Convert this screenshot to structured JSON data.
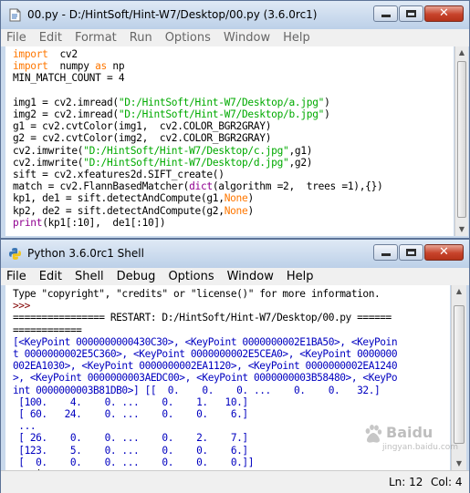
{
  "editor": {
    "title": "00.py - D:/HintSoft/Hint-W7/Desktop/00.py (3.6.0rc1)",
    "menu": [
      "File",
      "Edit",
      "Format",
      "Run",
      "Options",
      "Window",
      "Help"
    ],
    "code": [
      [
        [
          "kw",
          "import"
        ],
        [
          "",
          "  cv2"
        ]
      ],
      [
        [
          "kw",
          "import"
        ],
        [
          "",
          "  numpy "
        ],
        [
          "kw",
          "as"
        ],
        [
          "",
          " np"
        ]
      ],
      [
        [
          "",
          "MIN_MATCH_COUNT = 4"
        ]
      ],
      [
        [
          "",
          ""
        ]
      ],
      [
        [
          "",
          "img1 = cv2.imread("
        ],
        [
          "str",
          "\"D:/HintSoft/Hint-W7/Desktop/a.jpg\""
        ],
        [
          "",
          ")"
        ]
      ],
      [
        [
          "",
          "img2 = cv2.imread("
        ],
        [
          "str",
          "\"D:/HintSoft/Hint-W7/Desktop/b.jpg\""
        ],
        [
          "",
          ")"
        ]
      ],
      [
        [
          "",
          "g1 = cv2.cvtColor(img1,  cv2.COLOR_BGR2GRAY)"
        ]
      ],
      [
        [
          "",
          "g2 = cv2.cvtColor(img2,  cv2.COLOR_BGR2GRAY)"
        ]
      ],
      [
        [
          "",
          "cv2.imwrite("
        ],
        [
          "str",
          "\"D:/HintSoft/Hint-W7/Desktop/c.jpg\""
        ],
        [
          "",
          ",g1)"
        ]
      ],
      [
        [
          "",
          "cv2.imwrite("
        ],
        [
          "str",
          "\"D:/HintSoft/Hint-W7/Desktop/d.jpg\""
        ],
        [
          "",
          ",g2)"
        ]
      ],
      [
        [
          "",
          "sift = cv2.xfeatures2d.SIFT_create()"
        ]
      ],
      [
        [
          "",
          "match = cv2.FlannBasedMatcher("
        ],
        [
          "bi",
          "dict"
        ],
        [
          "",
          "(algorithm =2,  trees =1),{})"
        ]
      ],
      [
        [
          "",
          "kp1, de1 = sift.detectAndCompute(g1,"
        ],
        [
          "kw",
          "None"
        ],
        [
          "",
          ")"
        ]
      ],
      [
        [
          "",
          "kp2, de2 = sift.detectAndCompute(g2,"
        ],
        [
          "kw",
          "None"
        ],
        [
          "",
          ")"
        ]
      ],
      [
        [
          "bi",
          "print"
        ],
        [
          "",
          "(kp1[:10],  de1[:10])"
        ]
      ]
    ]
  },
  "shell": {
    "title": "Python 3.6.0rc1 Shell",
    "menu": [
      "File",
      "Edit",
      "Shell",
      "Debug",
      "Options",
      "Window",
      "Help"
    ],
    "lines": [
      [
        [
          "",
          "Type \"copyright\", \"credits\" or \"license()\" for more information."
        ]
      ],
      [
        [
          "prompt",
          ">>> "
        ]
      ],
      [
        [
          "",
          "================ RESTART: D:/HintSoft/Hint-W7/Desktop/00.py ======"
        ]
      ],
      [
        [
          "",
          "============"
        ]
      ],
      [
        [
          "out",
          "[<KeyPoint 0000000000430C30>, <KeyPoint 0000000002E1BA50>, <KeyPoin"
        ]
      ],
      [
        [
          "out",
          "t 0000000002E5C360>, <KeyPoint 0000000002E5CEA0>, <KeyPoint 0000000"
        ]
      ],
      [
        [
          "out",
          "002EA1030>, <KeyPoint 0000000002EA1120>, <KeyPoint 0000000002EA1240"
        ]
      ],
      [
        [
          "out",
          ">, <KeyPoint 0000000003AEDC00>, <KeyPoint 0000000003B58480>, <KeyPo"
        ]
      ],
      [
        [
          "out",
          "int 0000000003B81DB0>] [[  0.    0.    0. ...    0.    0.   32.]"
        ]
      ],
      [
        [
          "out",
          " [100.    4.    0. ...    0.    1.   10.]"
        ]
      ],
      [
        [
          "out",
          " [ 60.   24.    0. ...    0.    0.    6.]"
        ]
      ],
      [
        [
          "out",
          " ..."
        ]
      ],
      [
        [
          "out",
          " [ 26.    0.    0. ...    0.    2.    7.]"
        ]
      ],
      [
        [
          "out",
          " [123.    5.    0. ...    0.    0.    6.]"
        ]
      ],
      [
        [
          "out",
          " [  0.    0.    0. ...    0.    0.    0.]]"
        ]
      ],
      [
        [
          "prompt",
          ">>> "
        ],
        [
          "",
          "|"
        ]
      ]
    ],
    "status": {
      "ln": "Ln: 12",
      "col": "Col: 4"
    }
  },
  "watermark": {
    "name": "Baidu",
    "url": "jingyan.baidu.com"
  },
  "colors": {
    "keyword": "#ff7700",
    "string": "#00aa00",
    "builtin": "#900090",
    "output": "#0000c0",
    "prompt": "#800000"
  }
}
